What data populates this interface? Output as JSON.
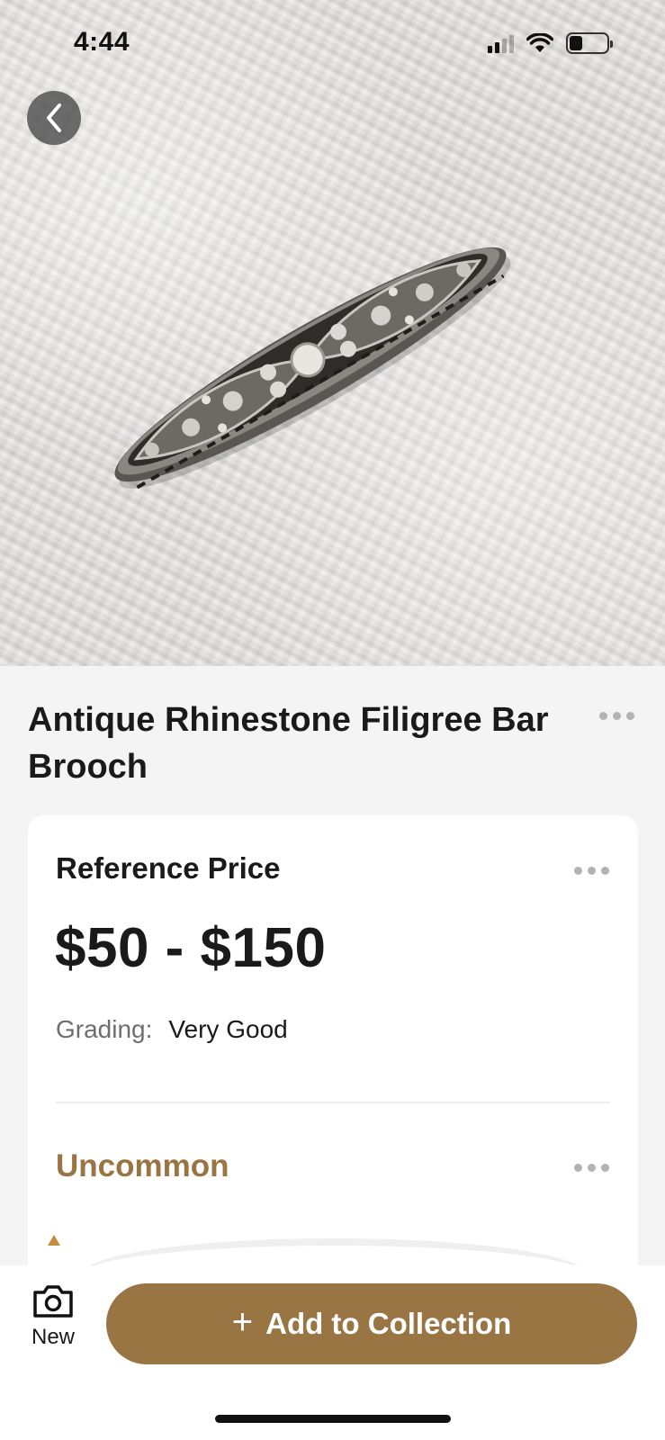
{
  "status_bar": {
    "time": "4:44",
    "signal_icon": "cellular-signal-icon",
    "wifi_icon": "wifi-icon",
    "battery_icon": "battery-icon"
  },
  "header": {
    "back_icon": "chevron-left-icon"
  },
  "photo": {
    "subject": "brooch-photo"
  },
  "item": {
    "title": "Antique Rhinestone Filigree Bar Brooch"
  },
  "price_card": {
    "label": "Reference Price",
    "price": "$50 - $150",
    "grading_label": "Grading:",
    "grading_value": "Very Good",
    "rarity": "Uncommon"
  },
  "bottom_bar": {
    "new_label": "New",
    "new_icon": "camera-icon",
    "add_plus": "+",
    "add_label": "Add to Collection"
  },
  "colors": {
    "accent": "#9a7544",
    "background": "#f4f4f4",
    "card": "#ffffff",
    "text": "#1a1a1a",
    "muted": "#6e6e6e"
  }
}
